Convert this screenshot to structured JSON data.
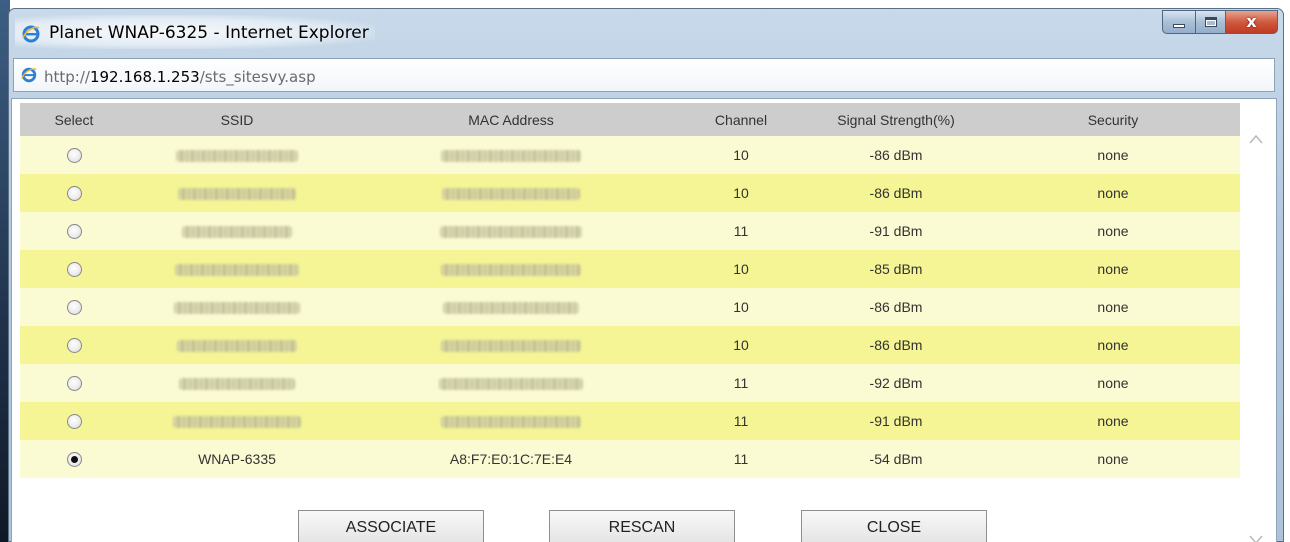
{
  "window": {
    "title": "Planet WNAP-6325 - Internet Explorer",
    "controls": {
      "close": "x"
    }
  },
  "address": {
    "scheme": "http://",
    "host": "192.168.1.253",
    "path": "/sts_sitesvy.asp"
  },
  "table": {
    "headers": [
      "Select",
      "SSID",
      "MAC Address",
      "Channel",
      "Signal Strength(%)",
      "Security"
    ],
    "rows": [
      {
        "selected": false,
        "ssid_hidden": true,
        "ssid": "",
        "mac_hidden": true,
        "mac": "",
        "channel": "10",
        "signal": "-86 dBm",
        "security": "none"
      },
      {
        "selected": false,
        "ssid_hidden": true,
        "ssid": "",
        "mac_hidden": true,
        "mac": "",
        "channel": "10",
        "signal": "-86 dBm",
        "security": "none"
      },
      {
        "selected": false,
        "ssid_hidden": true,
        "ssid": "",
        "mac_hidden": true,
        "mac": "",
        "channel": "11",
        "signal": "-91 dBm",
        "security": "none"
      },
      {
        "selected": false,
        "ssid_hidden": true,
        "ssid": "",
        "mac_hidden": true,
        "mac": "",
        "channel": "10",
        "signal": "-85 dBm",
        "security": "none"
      },
      {
        "selected": false,
        "ssid_hidden": true,
        "ssid": "",
        "mac_hidden": true,
        "mac": "",
        "channel": "10",
        "signal": "-86 dBm",
        "security": "none"
      },
      {
        "selected": false,
        "ssid_hidden": true,
        "ssid": "",
        "mac_hidden": true,
        "mac": "",
        "channel": "10",
        "signal": "-86 dBm",
        "security": "none"
      },
      {
        "selected": false,
        "ssid_hidden": true,
        "ssid": "",
        "mac_hidden": true,
        "mac": "",
        "channel": "11",
        "signal": "-92 dBm",
        "security": "none"
      },
      {
        "selected": false,
        "ssid_hidden": true,
        "ssid": "",
        "mac_hidden": true,
        "mac": "",
        "channel": "11",
        "signal": "-91 dBm",
        "security": "none"
      },
      {
        "selected": true,
        "ssid_hidden": false,
        "ssid": "WNAP-6335",
        "mac_hidden": false,
        "mac": "A8:F7:E0:1C:7E:E4",
        "channel": "11",
        "signal": "-54 dBm",
        "security": "none"
      }
    ]
  },
  "buttons": {
    "associate": "ASSOCIATE",
    "rescan": "RESCAN",
    "close": "CLOSE"
  },
  "icons": {
    "browser": "ie-icon",
    "page": "ie-page-icon",
    "scroll_up": "chevron-up-icon",
    "scroll_down": "chevron-down-icon"
  },
  "colors": {
    "row_light": "#fbfbd3",
    "row_dark": "#f5f595",
    "header_bg": "#cdcdcd",
    "close_button": "#c03a22"
  }
}
